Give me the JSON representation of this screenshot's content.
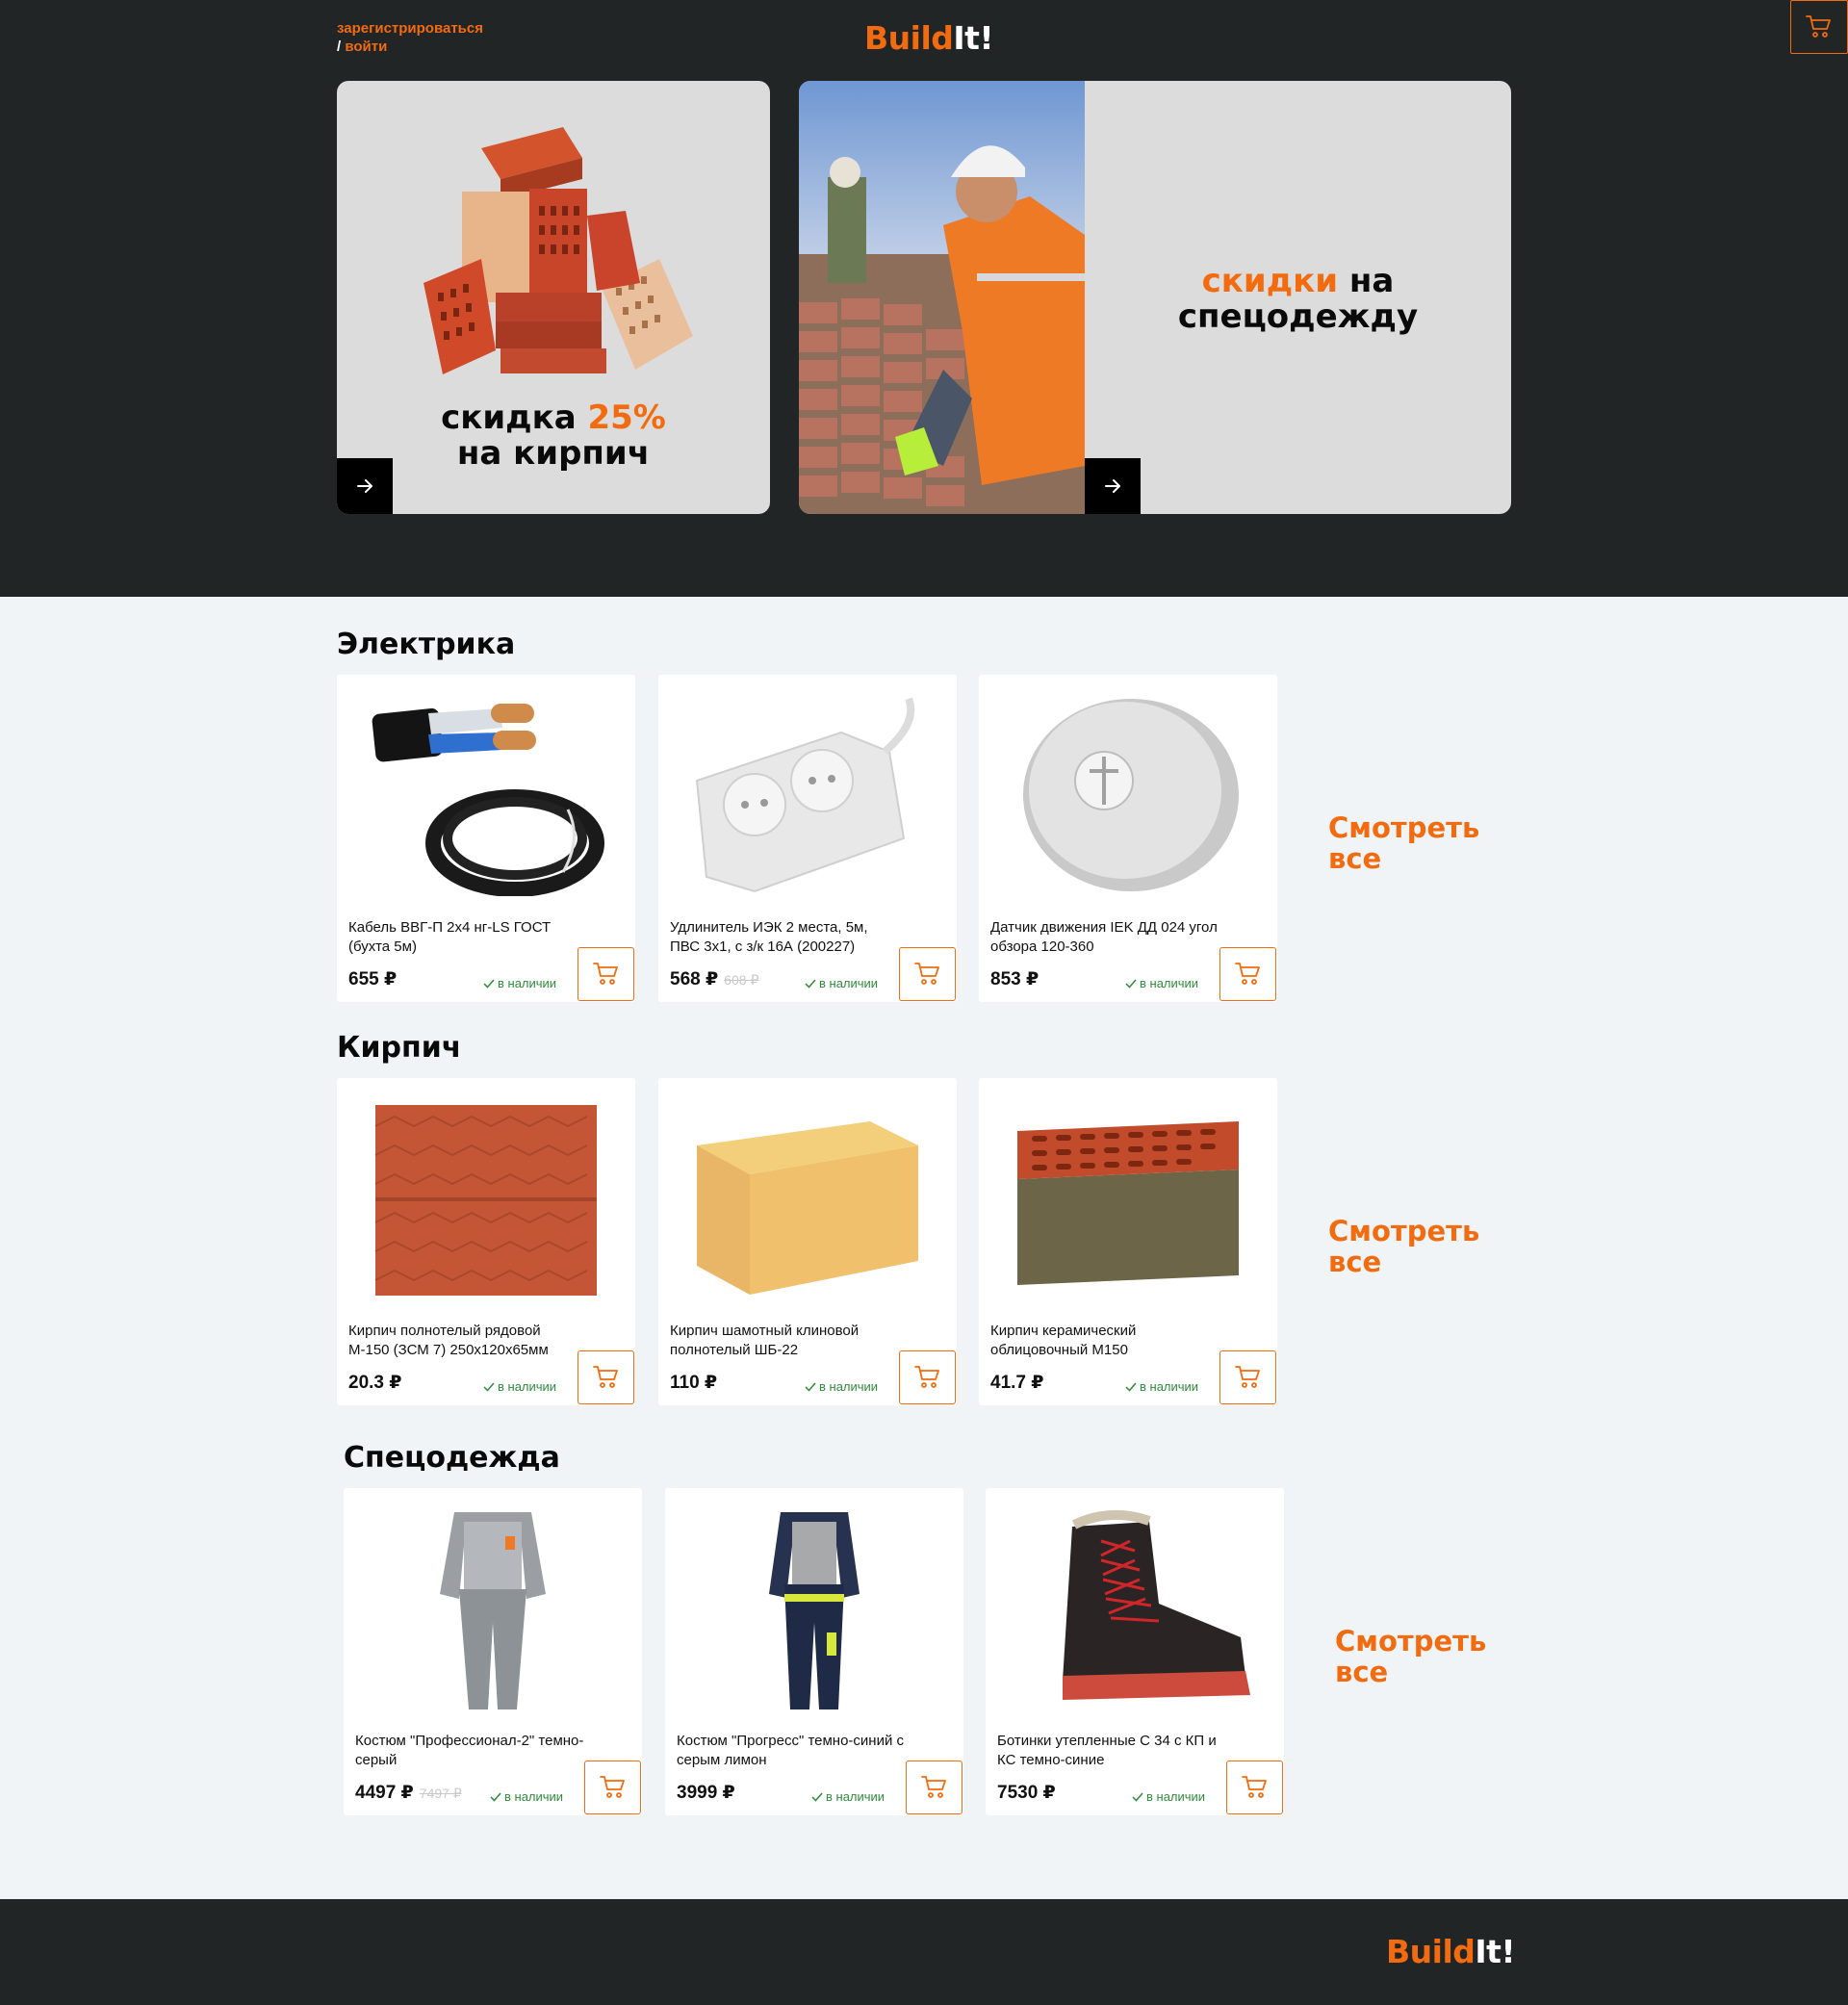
{
  "header": {
    "register_label": "зарегистрироваться",
    "slash": "/",
    "login_label": "войти",
    "logo_part1": "Build",
    "logo_part2": "It!"
  },
  "banners": [
    {
      "line1_pre": "скидка ",
      "line1_accent": "25%",
      "line2": "на кирпич"
    },
    {
      "line1_accent": "скидки",
      "line1_post": " на",
      "line2": "спецодежду"
    }
  ],
  "sections": [
    {
      "title": "Электрика",
      "see_all": [
        "Смотреть",
        "все"
      ],
      "products": [
        {
          "name": "Кабель ВВГ-П 2х4 нг-LS ГОСТ (бухта 5м)",
          "price": "655 ₽",
          "old_price": "",
          "stock": "в наличии",
          "image": "cable"
        },
        {
          "name": "Удлинитель ИЭК 2 места, 5м, ПВС 3х1, с з/к 16А (200227)",
          "price": "568 ₽",
          "old_price": "608 ₽",
          "stock": "в наличии",
          "image": "extension-cord"
        },
        {
          "name": "Датчик движения IEK ДД 024 угол обзора 120-360",
          "price": "853 ₽",
          "old_price": "",
          "stock": "в наличии",
          "image": "motion-sensor"
        }
      ]
    },
    {
      "title": "Кирпич",
      "see_all": [
        "Смотреть",
        "все"
      ],
      "products": [
        {
          "name": "Кирпич полнотелый рядовой М-150 (ЗСМ 7) 250х120х65мм",
          "price": "20.3 ₽",
          "old_price": "",
          "stock": "в наличии",
          "image": "red-brick"
        },
        {
          "name": "Кирпич шамотный клиновой полнотелый ШБ-22",
          "price": "110 ₽",
          "old_price": "",
          "stock": "в наличии",
          "image": "fireclay-brick"
        },
        {
          "name": "Кирпич керамический облицовочный М150",
          "price": "41.7 ₽",
          "old_price": "",
          "stock": "в наличии",
          "image": "facing-brick"
        }
      ]
    },
    {
      "title": "Спецодежда",
      "see_all": [
        "Смотреть",
        "все"
      ],
      "products": [
        {
          "name": "Костюм \"Профессионал-2\" темно-серый",
          "price": "4497 ₽",
          "old_price": "7497 ₽",
          "stock": "в наличии",
          "image": "grey-suit"
        },
        {
          "name": "Костюм \"Прогресс\" темно-синий с серым лимон",
          "price": "3999 ₽",
          "old_price": "",
          "stock": "в наличии",
          "image": "navy-suit"
        },
        {
          "name": "Ботинки утепленные С 34 с КП и КС темно-синие",
          "price": "7530 ₽",
          "old_price": "",
          "stock": "в наличии",
          "image": "winter-boots"
        }
      ]
    }
  ],
  "footer": {
    "logo_part1": "Build",
    "logo_part2": "It!"
  },
  "colors": {
    "accent": "#f26b0f",
    "dark": "#222526",
    "page_bg": "#f0f4f7",
    "stock_green": "#2e8b3a"
  }
}
